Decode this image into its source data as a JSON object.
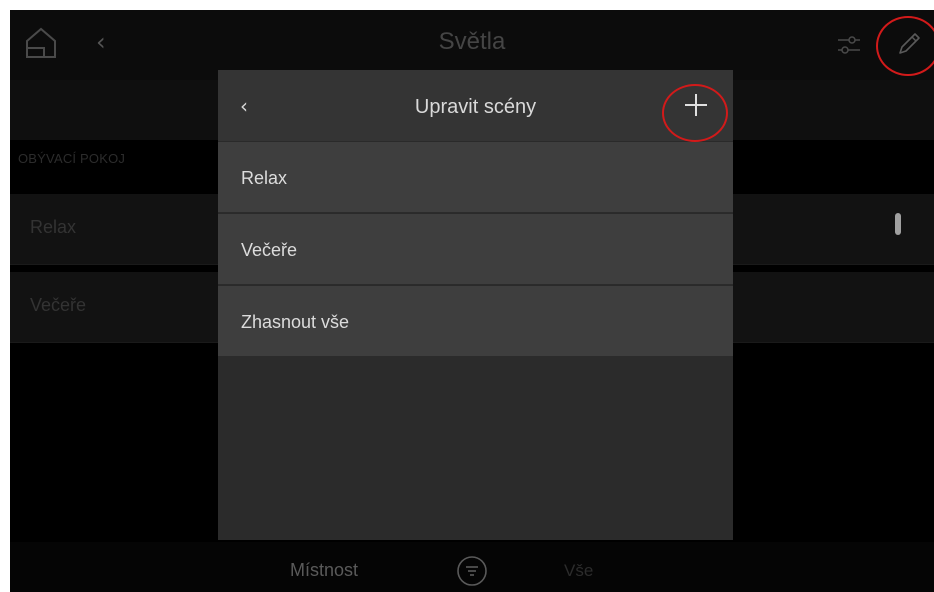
{
  "header": {
    "back_label": "‹",
    "title": "Světla",
    "settings_icon": "sliders-icon",
    "edit_icon": "pencil-icon"
  },
  "room": {
    "section_label": "OBÝVACÍ POKOJ",
    "rows": [
      {
        "label": "Relax"
      },
      {
        "label": "Večeře"
      }
    ]
  },
  "modal": {
    "back_label": "‹",
    "title": "Upravit scény",
    "add_icon": "plus-icon",
    "items": [
      {
        "label": "Relax"
      },
      {
        "label": "Večeře"
      },
      {
        "label": "Zhasnout vše"
      }
    ]
  },
  "bottom_bar": {
    "room_tab": "Místnost",
    "filter_icon": "filter-icon",
    "all_tab": "Vše"
  },
  "annotation_color": "#d21a1a"
}
